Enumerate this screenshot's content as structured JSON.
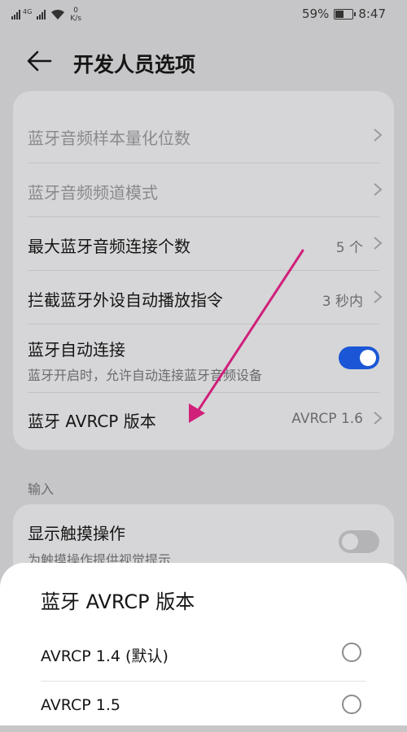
{
  "status_bar": {
    "network": "4G",
    "speed_value": "0",
    "speed_unit": "K/s",
    "battery": "59%",
    "battery_level": 0.59,
    "time": "8:47"
  },
  "header": {
    "title": "开发人员选项",
    "back_icon": "arrow-left-icon"
  },
  "bluetooth_card": {
    "items": [
      {
        "label": "蓝牙音频样本量化位数"
      },
      {
        "label": "蓝牙音频频道模式"
      },
      {
        "label": "最大蓝牙音频连接个数",
        "value": "5 个"
      },
      {
        "label": "拦截蓝牙外设自动播放指令",
        "value": "3 秒内"
      },
      {
        "label": "蓝牙自动连接",
        "sublabel": "蓝牙开启时，允许自动连接蓝牙音频设备",
        "toggle_on": true
      },
      {
        "label": "蓝牙 AVRCP 版本",
        "value": "AVRCP 1.6"
      }
    ]
  },
  "input_section": {
    "label": "输入",
    "items": [
      {
        "label": "显示触摸操作",
        "sublabel": "为触摸操作提供视觉提示",
        "toggle_on": false
      }
    ]
  },
  "sheet": {
    "title": "蓝牙 AVRCP 版本",
    "options": [
      {
        "label": "AVRCP 1.4 (默认)",
        "selected": false
      },
      {
        "label": "AVRCP 1.5",
        "selected": false
      }
    ]
  },
  "colors": {
    "accent": "#1a56d6",
    "annotation_arrow": "#d0207a",
    "background": "#c6c6c8",
    "card": "#d6d6d8"
  }
}
